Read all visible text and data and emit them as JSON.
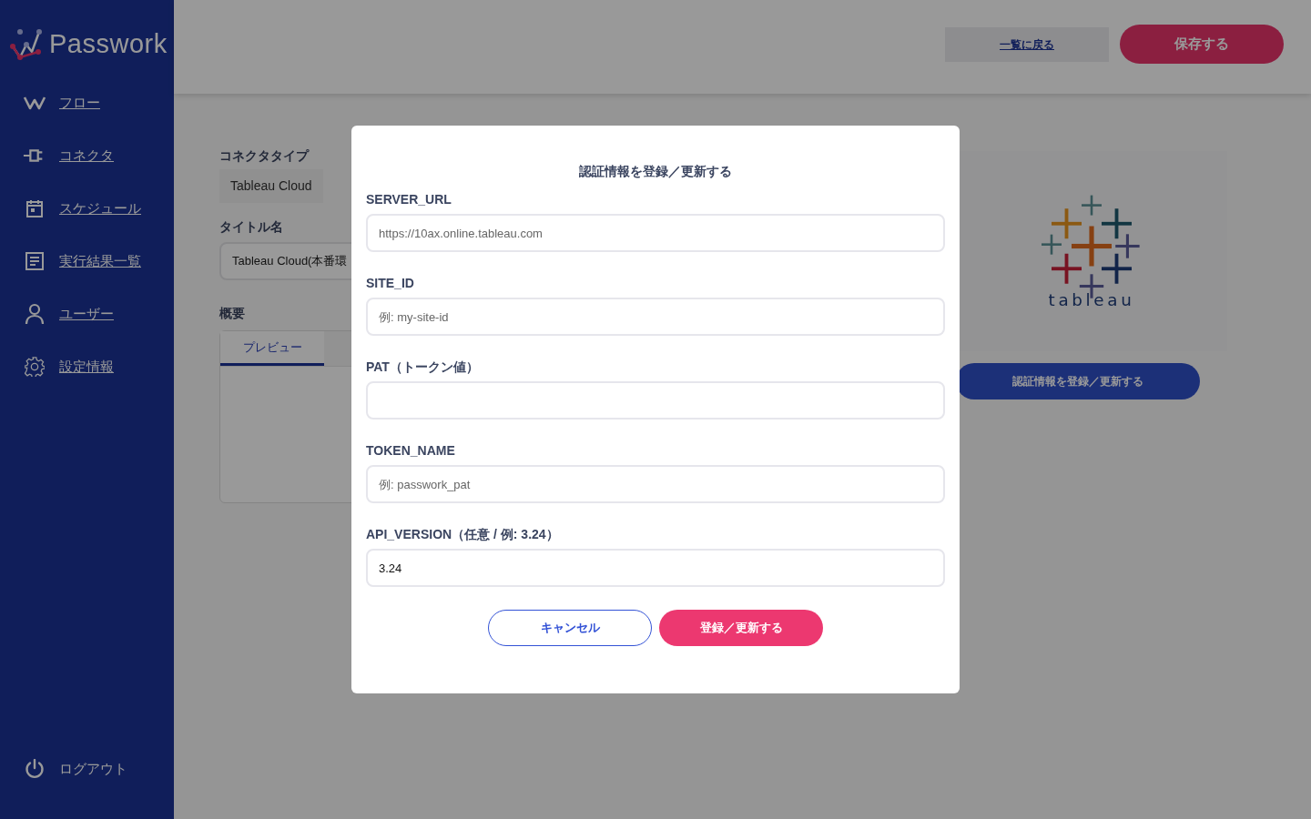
{
  "sidebar": {
    "logo": "Passwork",
    "items": [
      {
        "label": "フロー",
        "kind": "flow"
      },
      {
        "label": "コネクタ",
        "kind": "plug"
      },
      {
        "label": "スケジュール",
        "kind": "calendar"
      },
      {
        "label": "実行結果一覧",
        "kind": "list"
      },
      {
        "label": "ユーザー",
        "kind": "user"
      },
      {
        "label": "設定情報",
        "kind": "gear"
      }
    ],
    "logout": {
      "label": "ログアウト",
      "kind": "power"
    }
  },
  "header": {
    "buttons": [
      {
        "label": "一覧に戻る",
        "kind": "link"
      },
      {
        "label": "保存する",
        "kind": "primary"
      }
    ]
  },
  "form": {
    "connector_type_label": "コネクタタイプ",
    "connector_type": "Tableau Cloud",
    "title_label": "タイトル名",
    "title_value": "Tableau Cloud(本番環",
    "summary_label": "概要",
    "tabs": [
      {
        "label": "プレビュー",
        "selected": true
      }
    ]
  },
  "connector_panel": {
    "logo_text": "tableau",
    "button": "認証情報を登録／更新する"
  },
  "modal": {
    "title": "認証情報を登録／更新する",
    "fields": [
      {
        "label": "SERVER_URL",
        "placeholder": "https://10ax.online.tableau.com"
      },
      {
        "label": "SITE_ID",
        "placeholder": "例: my-site-id"
      },
      {
        "label": "PAT（トークン値）"
      },
      {
        "label": "TOKEN_NAME",
        "placeholder": "例: passwork_pat"
      },
      {
        "label": "API_VERSION（任意 / 例: 3.24）",
        "value": "3.24"
      }
    ],
    "buttons": [
      {
        "label": "キャンセル",
        "kind": "outline"
      },
      {
        "label": "登録／更新する",
        "kind": "primary"
      }
    ]
  }
}
